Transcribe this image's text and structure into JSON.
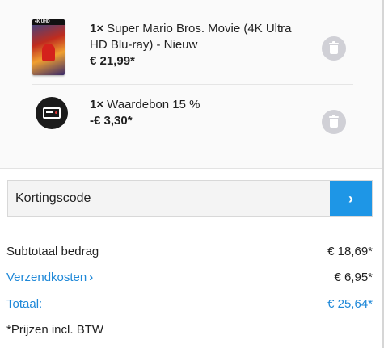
{
  "cart": {
    "items": [
      {
        "qty": "1×",
        "title": "Super Mario Bros. Movie (4K Ultra HD Blu-ray) - Nieuw",
        "price": "€ 21,99*",
        "thumb_icon": "bluray-cover-thumbnail",
        "thumb_band": "4K UHD"
      },
      {
        "qty": "1×",
        "title": "Waardebon 15 %",
        "price": "-€ 3,30*",
        "thumb_icon": "voucher-card-icon"
      }
    ],
    "delete_icon": "trash-icon"
  },
  "coupon": {
    "placeholder": "Kortingscode",
    "button_glyph": "›",
    "accent_color": "#1e96e6"
  },
  "summary": {
    "subtotal_label": "Subtotaal bedrag",
    "subtotal_value": "€ 18,69*",
    "shipping_label": "Verzendkosten",
    "shipping_chevron": "›",
    "shipping_value": "€ 6,95*",
    "total_label": "Totaal:",
    "total_value": "€ 25,64*",
    "tax_note": "*Prijzen incl. BTW",
    "link_color": "#1e88d8"
  }
}
